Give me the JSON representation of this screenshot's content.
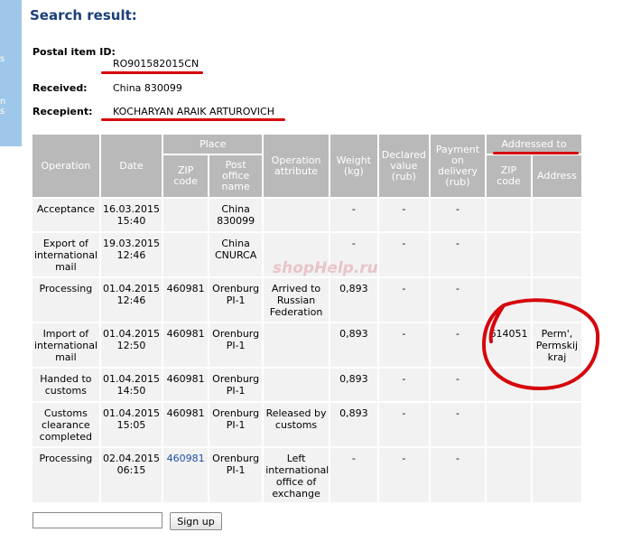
{
  "page": {
    "title": "Search result:"
  },
  "info": {
    "postal_item_label": "Postal item ID:",
    "postal_item_value": "RO901582015CN",
    "received_label": "Received:",
    "received_value": "China 830099",
    "recipient_label": "Recepient:",
    "recipient_value": "KOCHARYAN ARAIK ARTUROVICH"
  },
  "table": {
    "headers": {
      "operation": "Operation",
      "date": "Date",
      "place": "Place",
      "zip": "ZIP code",
      "post_office": "Post office name",
      "attribute": "Operation attribute",
      "weight": "Weight (kg)",
      "declared": "Declared value (rub)",
      "payment": "Payment on delivery (rub)",
      "addressed_to": "Addressed to",
      "addr_zip": "ZIP code",
      "address": "Address"
    },
    "rows": [
      {
        "operation": "Acceptance",
        "date": "16.03.2015 15:40",
        "zip": "",
        "office": "China 830099",
        "attribute": "",
        "weight": "-",
        "declared": "-",
        "payment": "-",
        "addr_zip": "",
        "address": ""
      },
      {
        "operation": "Export of international mail",
        "date": "19.03.2015 12:46",
        "zip": "",
        "office": "China CNURCA",
        "attribute": "",
        "weight": "-",
        "declared": "-",
        "payment": "-",
        "addr_zip": "",
        "address": ""
      },
      {
        "operation": "Processing",
        "date": "01.04.2015 12:46",
        "zip": "460981",
        "office": "Orenburg PI-1",
        "attribute": "Arrived to Russian Federation",
        "weight": "0,893",
        "declared": "-",
        "payment": "-",
        "addr_zip": "",
        "address": ""
      },
      {
        "operation": "Import of international mail",
        "date": "01.04.2015 12:50",
        "zip": "460981",
        "office": "Orenburg PI-1",
        "attribute": "",
        "weight": "0,893",
        "declared": "-",
        "payment": "-",
        "addr_zip": "614051",
        "address": "Perm', Permskij kraj"
      },
      {
        "operation": "Handed to customs",
        "date": "01.04.2015 14:50",
        "zip": "460981",
        "office": "Orenburg PI-1",
        "attribute": "",
        "weight": "0,893",
        "declared": "-",
        "payment": "-",
        "addr_zip": "",
        "address": ""
      },
      {
        "operation": "Customs clearance completed",
        "date": "01.04.2015 15:05",
        "zip": "460981",
        "office": "Orenburg PI-1",
        "attribute": "Released by customs",
        "weight": "0,893",
        "declared": "-",
        "payment": "-",
        "addr_zip": "",
        "address": ""
      },
      {
        "operation": "Processing",
        "date": "02.04.2015 06:15",
        "zip": "460981",
        "office": "Orenburg PI-1",
        "attribute": "Left international office of exchange",
        "weight": "-",
        "declared": "-",
        "payment": "-",
        "addr_zip": "",
        "address": ""
      }
    ]
  },
  "form": {
    "input_value": "",
    "button_label": "Sign up"
  },
  "watermark": "shopHelp.ru",
  "sidebar_fragments": [
    "s",
    "n",
    "s"
  ],
  "colors": {
    "title": "#1b3f7a",
    "header_bg": "#b9b9b9",
    "cell_bg": "#f2f2f2",
    "annotation_red": "#d6060c",
    "link": "#1b4fa8",
    "sidebar": "#9fc7ea"
  }
}
